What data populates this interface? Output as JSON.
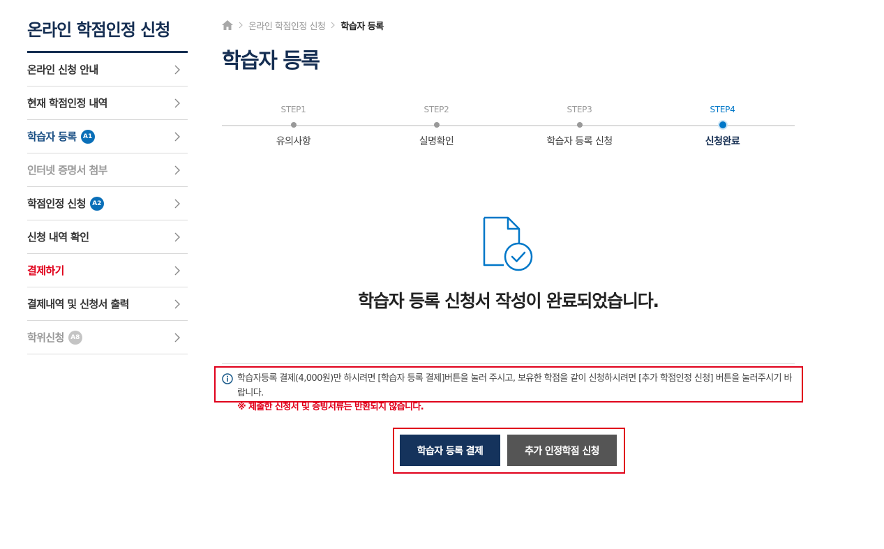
{
  "sidebar": {
    "title": "온라인 학점인정 신청",
    "items": [
      {
        "label": "온라인 신청 안내",
        "state": "normal"
      },
      {
        "label": "현재 학점인정 내역",
        "state": "normal"
      },
      {
        "label": "학습자 등록",
        "state": "active",
        "badge": "A1"
      },
      {
        "label": "인터넷 증명서 첨부",
        "state": "disabled"
      },
      {
        "label": "학점인정 신청",
        "state": "normal",
        "badge": "A2"
      },
      {
        "label": "신청 내역 확인",
        "state": "normal"
      },
      {
        "label": "결제하기",
        "state": "danger"
      },
      {
        "label": "결제내역 및 신청서 출력",
        "state": "normal"
      },
      {
        "label": "학위신청",
        "state": "disabled",
        "badge": "A8"
      }
    ]
  },
  "breadcrumb": {
    "icon": "home-icon",
    "items": [
      "온라인 학점인정 신청",
      "학습자 등록"
    ]
  },
  "page_title": "학습자 등록",
  "steps": [
    {
      "num": "STEP1",
      "label": "유의사항"
    },
    {
      "num": "STEP2",
      "label": "실명확인"
    },
    {
      "num": "STEP3",
      "label": "학습자 등록 신청"
    },
    {
      "num": "STEP4",
      "label": "신청완료",
      "current": true
    }
  ],
  "completion": {
    "icon": "document-check-icon",
    "message": "학습자 등록 신청서 작성이 완료되었습니다."
  },
  "notice": {
    "text": "학습자등록 결제(4,000원)만 하시려면 [학습자 등록 결제]버튼을 눌러 주시고, 보유한 학점을 같이 신청하시려면 [추가 학점인정 신청] 버튼을 눌러주시기 바랍니다.",
    "warning": "※ 제출한 신청서 및 증빙서류는 반환되지 않습니다."
  },
  "buttons": {
    "pay": "학습자 등록 결제",
    "apply": "추가 인정학점 신청"
  },
  "colors": {
    "navy": "#152e52",
    "active": "#1a4f84",
    "accent_blue": "#0077c8",
    "danger": "#e0001b",
    "badge_blue": "#0a6fb8",
    "badge_grey": "#c4c4c4",
    "button_primary": "#15335c",
    "button_secondary": "#555555"
  }
}
